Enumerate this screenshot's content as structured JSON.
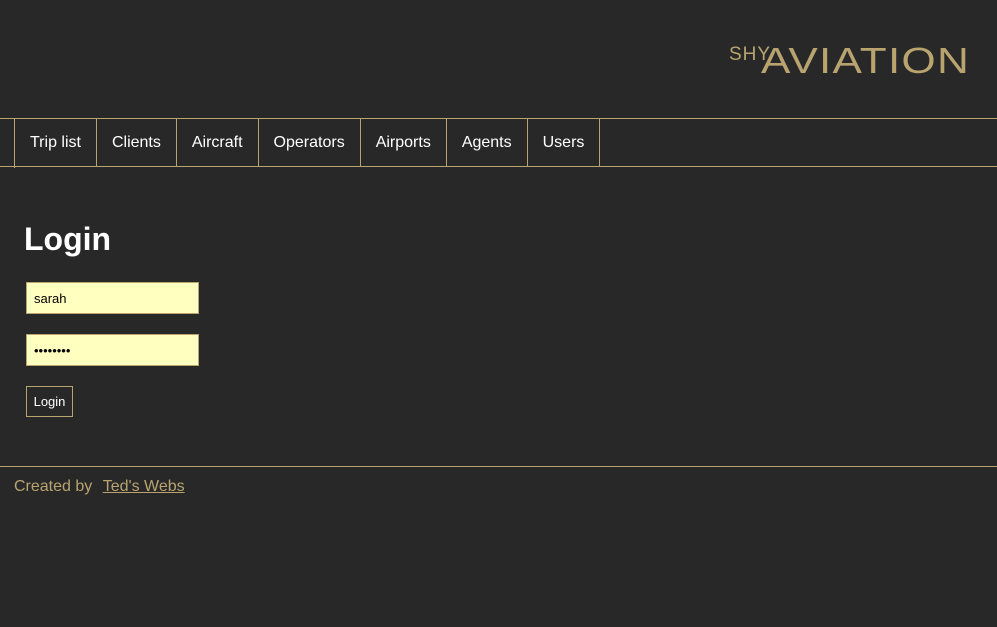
{
  "colors": {
    "background": "#282828",
    "accent": "#b9a470",
    "input_background": "#ffffc0",
    "text": "#ffffff"
  },
  "header": {
    "logo": {
      "prefix": "SHY",
      "name": "AVIATION"
    }
  },
  "nav": {
    "items": [
      {
        "label": "Trip list"
      },
      {
        "label": "Clients"
      },
      {
        "label": "Aircraft"
      },
      {
        "label": "Operators"
      },
      {
        "label": "Airports"
      },
      {
        "label": "Agents"
      },
      {
        "label": "Users"
      }
    ]
  },
  "login": {
    "title": "Login",
    "username_value": "sarah",
    "password_value": "password",
    "submit_label": "Login"
  },
  "footer": {
    "created_by": "Created by",
    "link_text": "Ted's Webs"
  }
}
